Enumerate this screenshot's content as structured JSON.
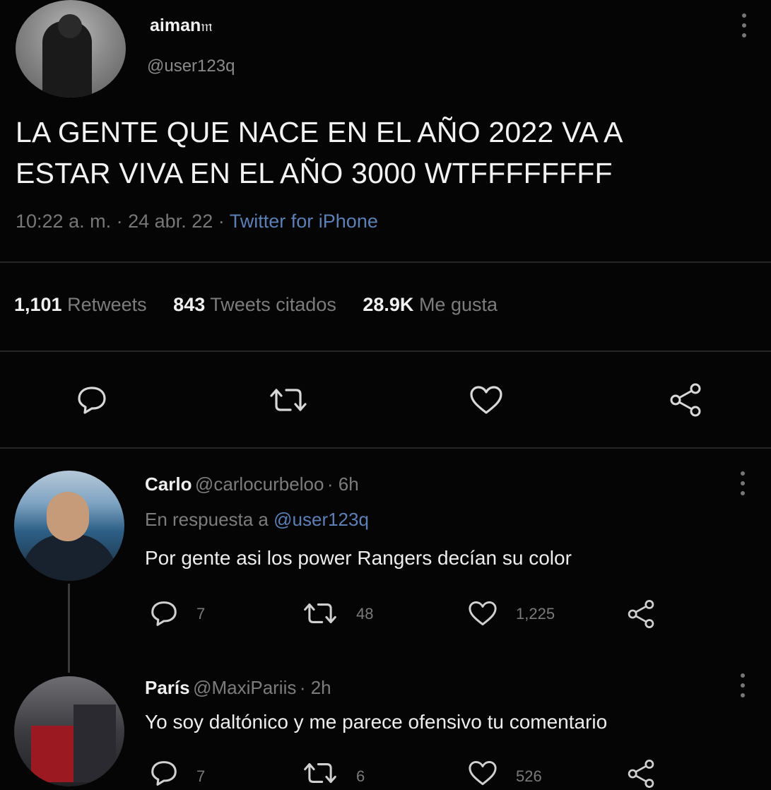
{
  "tweet": {
    "display_name": "aiman",
    "name_suffix": "𝔪",
    "handle": "@user123q",
    "text_line1": "LA GENTE QUE NACE EN EL AÑO 2022 VA A",
    "text_line2": "ESTAR VIVA EN EL AÑO 3000 WTFFFFFFFF",
    "time": "10:22 a. m.",
    "date": "24 abr. 22",
    "separator": "·",
    "source": "Twitter for iPhone",
    "stats": {
      "retweets_count": "1,101",
      "retweets_label": "Retweets",
      "quotes_count": "843",
      "quotes_label": "Tweets citados",
      "likes_count": "28.9K",
      "likes_label": "Me gusta"
    }
  },
  "replies": [
    {
      "name": "Carlo",
      "handle": "@carlocurbeloo",
      "age": "· 6h",
      "reply_to_label": "En respuesta a",
      "reply_to_handle": "@user123q",
      "text": "Por gente asi los power Rangers decían su color",
      "reply_count": "7",
      "retweet_count": "48",
      "like_count": "1,225"
    },
    {
      "name": "París",
      "handle": "@MaxiPariis",
      "age": "· 2h",
      "text": "Yo soy daltónico y me parece ofensivo tu comentario",
      "reply_count": "7",
      "retweet_count": "6",
      "like_count": "526"
    }
  ],
  "icons": {
    "reply": "speech-bubble",
    "retweet": "retweet-arrows",
    "like": "heart",
    "share": "share-nodes",
    "more": "vertical-dots"
  },
  "colors": {
    "background": "#050505",
    "link": "#5c7fb6",
    "muted": "#7c7c7c"
  }
}
